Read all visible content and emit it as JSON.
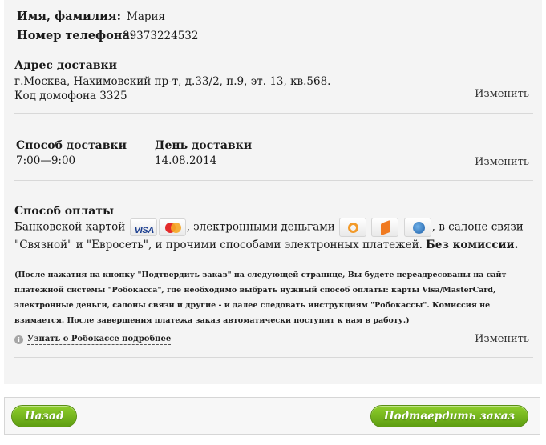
{
  "customer": {
    "name_label": "Имя, фамилия:",
    "name_value": "Мария",
    "phone_label": "Номер телефона:",
    "phone_value": "89373224532"
  },
  "address": {
    "title": "Адрес доставки",
    "line1": "г.Москва, Нахимовский пр-т, д.33/2, п.9, эт. 13, кв.568.",
    "line2": "Код домофона 3325",
    "change_link": "Изменить"
  },
  "delivery": {
    "method_label": "Способ доставки",
    "method_value": "7:00—9:00",
    "day_label": "День доставки",
    "day_value": "14.08.2014",
    "change_link": "Изменить"
  },
  "payment": {
    "title": "Способ оплаты",
    "text_card": "Банковской картой",
    "text_emoney": ", электронными деньгами",
    "text_salons": ", в салоне связи \"Связной\" и \"Евросеть\", и прочими способами электронных платежей.",
    "text_no_fee": "Без комиссии.",
    "note": "(После нажатия на кнопку \"Подтвердить заказ\" на следующей странице, Вы будете переадресованы на сайт платежной системы \"Робокасса\", где необходимо выбрать нужный способ оплаты: карты Visa/MasterCard, электронные деньги, салоны связи и другие - и далее следовать инструкциям \"Робокассы\". Комиссия не взимается. После завершения платежа заказ автоматически поступит к нам в работу.)",
    "robokassa_link": "Узнать о Робокассе подробнее",
    "change_link": "Изменить",
    "icons": {
      "visa_text": "VISA",
      "visa": "visa-card-icon",
      "mastercard": "mastercard-icon",
      "qiwi": "qiwi-icon",
      "yandex": "yandex-money-icon",
      "webmoney": "webmoney-icon"
    }
  },
  "buttons": {
    "back": "Назад",
    "confirm": "Подтвердить заказ"
  },
  "colors": {
    "panel_bg": "#f4f4f4",
    "button_green": "#6fae17",
    "divider": "#d8d8d8"
  }
}
